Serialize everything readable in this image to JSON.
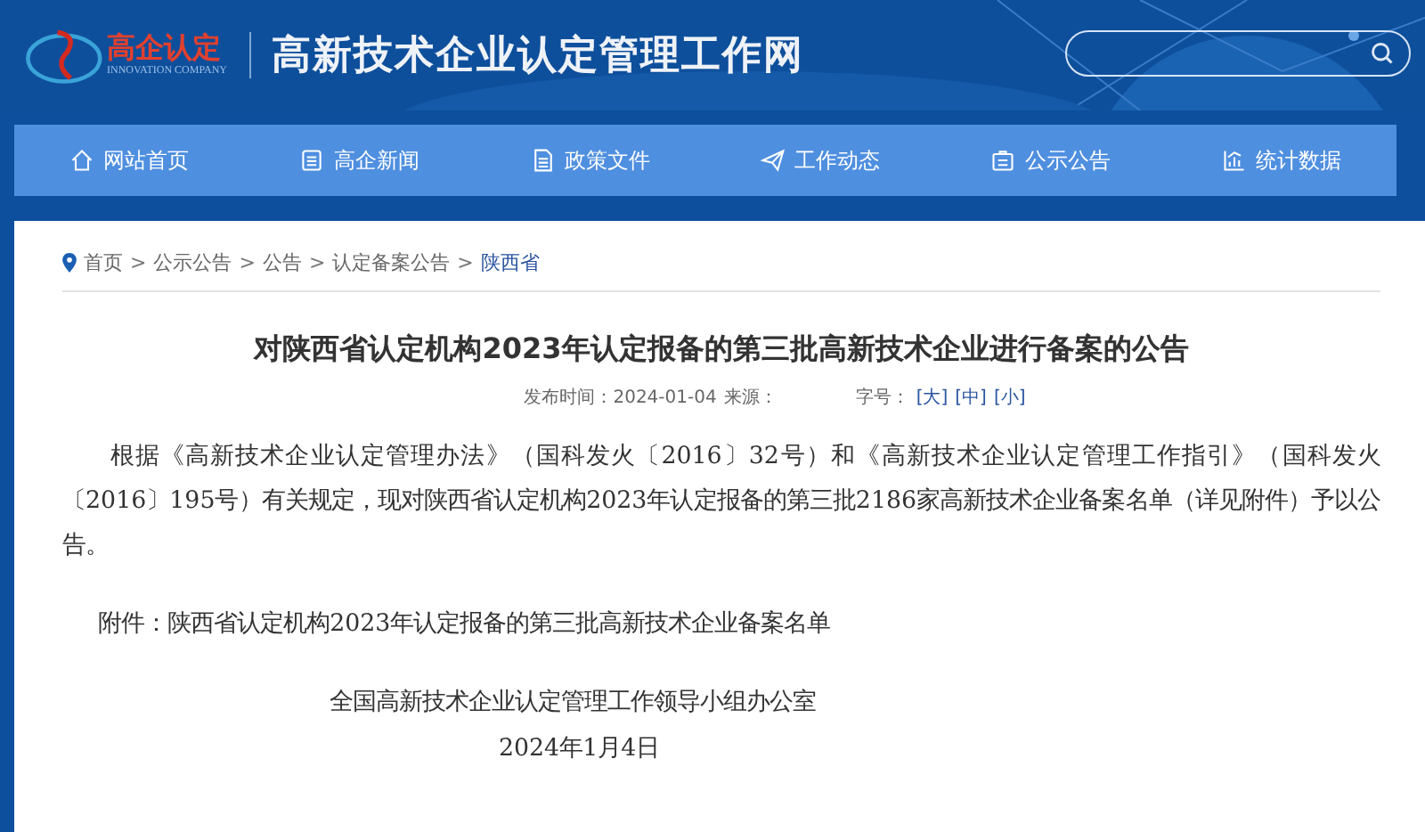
{
  "logo": {
    "name": "高企认定",
    "subtitle": "INNOVATION COMPANY"
  },
  "site_title": "高新技术企业认定管理工作网",
  "nav": [
    {
      "label": "网站首页",
      "kind": "home"
    },
    {
      "label": "高企新闻",
      "kind": "news"
    },
    {
      "label": "政策文件",
      "kind": "doc"
    },
    {
      "label": "工作动态",
      "kind": "plane"
    },
    {
      "label": "公示公告",
      "kind": "board"
    },
    {
      "label": "统计数据",
      "kind": "chart"
    }
  ],
  "breadcrumb_separator": ">",
  "breadcrumb": [
    {
      "label": "首页",
      "selected": false
    },
    {
      "label": "公示公告",
      "selected": false
    },
    {
      "label": "公告",
      "selected": false
    },
    {
      "label": "认定备案公告",
      "selected": false
    },
    {
      "label": "陕西省",
      "selected": true
    }
  ],
  "article": {
    "title": "对陕西省认定机构2023年认定报备的第三批高新技术企业进行备案的公告",
    "published": "发布时间：2024-01-04",
    "source": "来源：",
    "font_size_label": "字号：",
    "font_sizes": [
      "[大]",
      "[中]",
      "[小]"
    ],
    "body": "根据《高新技术企业认定管理办法》（国科发火〔2016〕32号）和《高新技术企业认定管理工作指引》（国科发火〔2016〕195号）有关规定，现对陕西省认定机构2023年认定报备的第三批2186家高新技术企业备案名单（详见附件）予以公告。",
    "attachment": "附件：陕西省认定机构2023年认定报备的第三批高新技术企业备案名单",
    "signature": "全国高新技术企业认定管理工作领导小组办公室",
    "date": "2024年1月4日"
  }
}
